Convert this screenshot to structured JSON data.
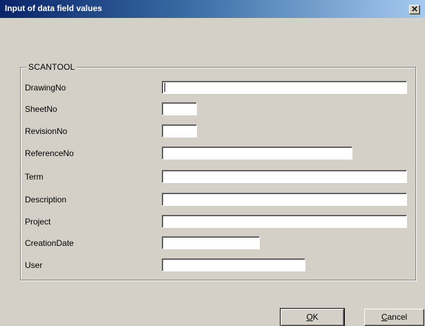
{
  "window": {
    "title": "Input of data field values",
    "close_glyph": "×"
  },
  "group": {
    "label": "SCANTOOL"
  },
  "fields": [
    {
      "label": "DrawingNo",
      "value": ""
    },
    {
      "label": "SheetNo",
      "value": ""
    },
    {
      "label": "RevisionNo",
      "value": ""
    },
    {
      "label": "ReferenceNo",
      "value": ""
    },
    {
      "label": "Term",
      "value": ""
    },
    {
      "label": "Description",
      "value": ""
    },
    {
      "label": "Project",
      "value": ""
    },
    {
      "label": "CreationDate",
      "value": ""
    },
    {
      "label": "User",
      "value": ""
    }
  ],
  "buttons": {
    "ok_mnemonic": "O",
    "ok_rest": "K",
    "cancel_mnemonic": "C",
    "cancel_rest": "ancel"
  }
}
